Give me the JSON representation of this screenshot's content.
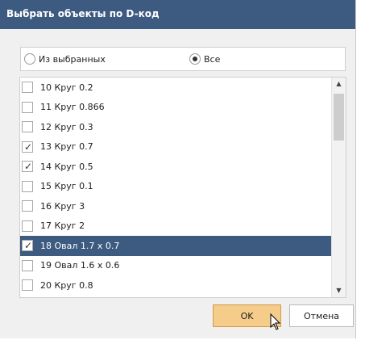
{
  "dialog": {
    "title": "Выбрать объекты по D-код",
    "radio": [
      {
        "label": "Из выбранных",
        "checked": false
      },
      {
        "label": "Все",
        "checked": true
      }
    ],
    "items": [
      {
        "label": "10 Круг 0.2",
        "checked": false,
        "selected": false
      },
      {
        "label": "11 Круг 0.866",
        "checked": false,
        "selected": false
      },
      {
        "label": "12 Круг 0.3",
        "checked": false,
        "selected": false
      },
      {
        "label": "13 Круг 0.7",
        "checked": true,
        "selected": false
      },
      {
        "label": "14 Круг 0.5",
        "checked": true,
        "selected": false
      },
      {
        "label": "15 Круг 0.1",
        "checked": false,
        "selected": false
      },
      {
        "label": "16 Круг 3",
        "checked": false,
        "selected": false
      },
      {
        "label": "17 Круг 2",
        "checked": false,
        "selected": false
      },
      {
        "label": "18 Овал 1.7 x 0.7",
        "checked": true,
        "selected": true
      },
      {
        "label": "19 Овал 1.6 x 0.6",
        "checked": false,
        "selected": false
      },
      {
        "label": "20 Круг 0.8",
        "checked": false,
        "selected": false
      }
    ],
    "buttons": {
      "ok": "OK",
      "cancel": "Отмена"
    },
    "colors": {
      "accent": "#3d5a80",
      "ok_button": "#f6cc8a"
    }
  }
}
